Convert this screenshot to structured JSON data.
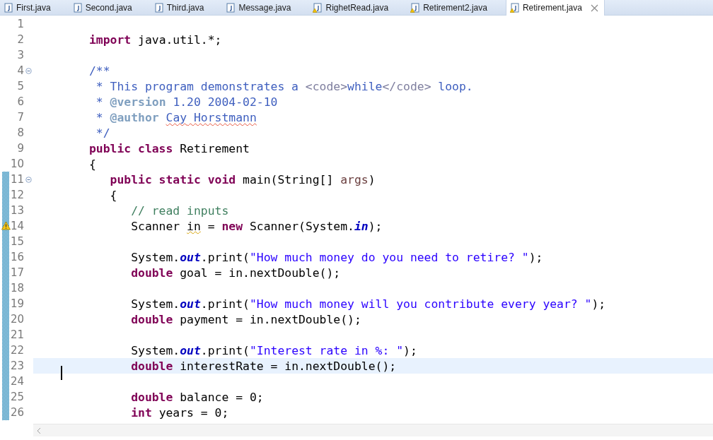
{
  "tabs": [
    {
      "label": "First.java",
      "kind": "java",
      "selected": false
    },
    {
      "label": "Second.java",
      "kind": "java",
      "selected": false
    },
    {
      "label": "Third.java",
      "kind": "java",
      "selected": false
    },
    {
      "label": "Message.java",
      "kind": "java",
      "selected": false
    },
    {
      "label": "RighetRead.java",
      "kind": "java-warning",
      "selected": false
    },
    {
      "label": "Retirement2.java",
      "kind": "java-warning",
      "selected": false
    },
    {
      "label": "Retirement.java",
      "kind": "java-warning",
      "selected": true,
      "closable": true
    }
  ],
  "editor": {
    "lines": [
      {
        "number": "1",
        "changed": false
      },
      {
        "number": "2",
        "changed": false,
        "tokens": [
          {
            "kind": "keyword",
            "text": "        import"
          },
          {
            "kind": "text",
            "text": " java.util.*;"
          }
        ]
      },
      {
        "number": "3",
        "changed": false
      },
      {
        "number": "4",
        "changed": false,
        "fold": true,
        "tokens": [
          {
            "kind": "doc",
            "text": "        /**"
          }
        ]
      },
      {
        "number": "5",
        "changed": false,
        "tokens": [
          {
            "kind": "doc",
            "text": "         * This program demonstrates a "
          },
          {
            "kind": "doc-html",
            "text": "<code>"
          },
          {
            "kind": "doc",
            "text": "while"
          },
          {
            "kind": "doc-html",
            "text": "</code>"
          },
          {
            "kind": "doc",
            "text": " loop."
          }
        ]
      },
      {
        "number": "6",
        "changed": false,
        "tokens": [
          {
            "kind": "doc",
            "text": "         * "
          },
          {
            "kind": "doc-tag",
            "text": "@version"
          },
          {
            "kind": "doc",
            "text": " 1.20 2004-02-10"
          }
        ]
      },
      {
        "number": "7",
        "changed": false,
        "tokens": [
          {
            "kind": "doc",
            "text": "         * "
          },
          {
            "kind": "doc-tag",
            "text": "@author "
          },
          {
            "kind": "doc",
            "text": "Cay",
            "misspelled": true
          },
          {
            "kind": "doc",
            "text": " Horstmann",
            "misspelled": true
          }
        ]
      },
      {
        "number": "8",
        "changed": false,
        "tokens": [
          {
            "kind": "doc",
            "text": "         */"
          }
        ]
      },
      {
        "number": "9",
        "changed": false,
        "tokens": [
          {
            "kind": "keyword",
            "text": "        public class"
          },
          {
            "kind": "text",
            "text": " Retirement"
          }
        ]
      },
      {
        "number": "10",
        "changed": false,
        "tokens": [
          {
            "kind": "text",
            "text": "        {"
          }
        ]
      },
      {
        "number": "11",
        "fold": true,
        "changed": true,
        "tokens": [
          {
            "kind": "keyword",
            "text": "           public static void"
          },
          {
            "kind": "text",
            "text": " main(String[] "
          },
          {
            "kind": "param",
            "text": "args"
          },
          {
            "kind": "text",
            "text": ")"
          }
        ]
      },
      {
        "number": "12",
        "changed": true,
        "tokens": [
          {
            "kind": "text",
            "text": "           {"
          }
        ]
      },
      {
        "number": "13",
        "changed": true,
        "tokens": [
          {
            "kind": "comment",
            "text": "              // read inputs"
          }
        ]
      },
      {
        "number": "14",
        "changed": true,
        "warning": true,
        "tokens": [
          {
            "kind": "text",
            "text": "              Scanner "
          },
          {
            "kind": "text",
            "text": "in",
            "warned": true
          },
          {
            "kind": "text",
            "text": " = "
          },
          {
            "kind": "keyword",
            "text": "new"
          },
          {
            "kind": "text",
            "text": " Scanner(System."
          },
          {
            "kind": "static-field",
            "text": "in"
          },
          {
            "kind": "text",
            "text": ");"
          }
        ]
      },
      {
        "number": "15",
        "changed": true
      },
      {
        "number": "16",
        "changed": true,
        "tokens": [
          {
            "kind": "text",
            "text": "              System."
          },
          {
            "kind": "static-field",
            "text": "out"
          },
          {
            "kind": "text",
            "text": ".print("
          },
          {
            "kind": "string",
            "text": "\"How much money do you need to retire? \""
          },
          {
            "kind": "text",
            "text": ");"
          }
        ]
      },
      {
        "number": "17",
        "changed": true,
        "tokens": [
          {
            "kind": "keyword",
            "text": "              double"
          },
          {
            "kind": "text",
            "text": " goal = in.nextDouble();"
          }
        ]
      },
      {
        "number": "18",
        "changed": true
      },
      {
        "number": "19",
        "changed": true,
        "tokens": [
          {
            "kind": "text",
            "text": "              System."
          },
          {
            "kind": "static-field",
            "text": "out"
          },
          {
            "kind": "text",
            "text": ".print("
          },
          {
            "kind": "string",
            "text": "\"How much money will you contribute every year? \""
          },
          {
            "kind": "text",
            "text": ");"
          }
        ]
      },
      {
        "number": "20",
        "changed": true,
        "tokens": [
          {
            "kind": "keyword",
            "text": "              double"
          },
          {
            "kind": "text",
            "text": " payment = in.nextDouble();"
          }
        ]
      },
      {
        "number": "21",
        "changed": true
      },
      {
        "number": "22",
        "changed": true,
        "tokens": [
          {
            "kind": "text",
            "text": "              System."
          },
          {
            "kind": "static-field",
            "text": "out"
          },
          {
            "kind": "text",
            "text": ".print("
          },
          {
            "kind": "string",
            "text": "\"Interest rate in %: \""
          },
          {
            "kind": "text",
            "text": ");"
          }
        ]
      },
      {
        "number": "23",
        "changed": true,
        "current": true,
        "tokens": [
          {
            "kind": "keyword",
            "text": "              double"
          },
          {
            "kind": "text",
            "text": " interestRate = in.nextDouble();"
          }
        ]
      },
      {
        "number": "24",
        "changed": true
      },
      {
        "number": "25",
        "changed": true,
        "tokens": [
          {
            "kind": "keyword",
            "text": "              double"
          },
          {
            "kind": "text",
            "text": " balance = 0;"
          }
        ]
      },
      {
        "number": "26",
        "changed": true,
        "tokens": [
          {
            "kind": "keyword",
            "text": "              int"
          },
          {
            "kind": "text",
            "text": " years = 0;"
          }
        ]
      }
    ]
  }
}
